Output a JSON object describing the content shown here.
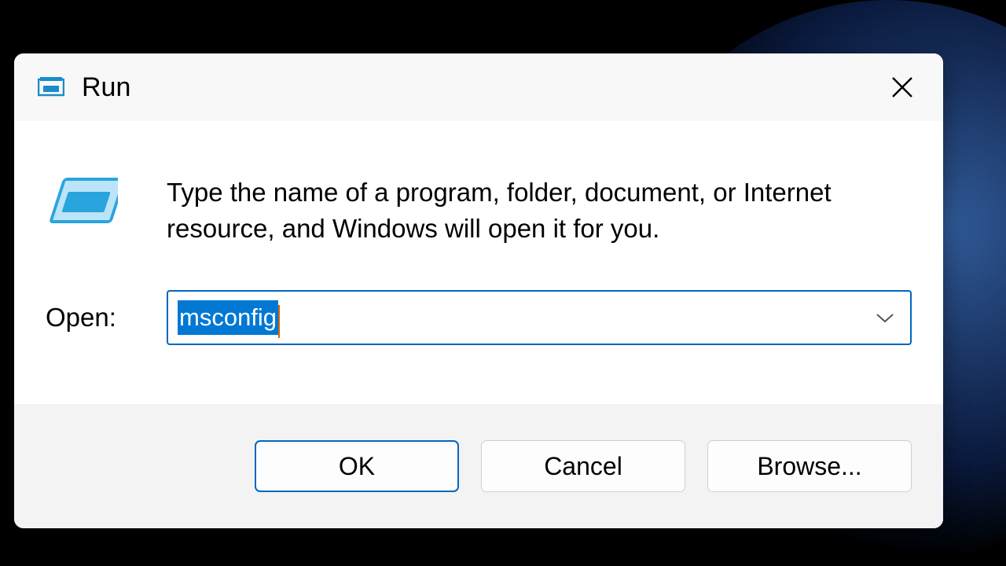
{
  "dialog": {
    "title": "Run",
    "description": "Type the name of a program, folder, document, or Internet resource, and Windows will open it for you.",
    "open_label": "Open:",
    "input_value": "msconfig",
    "buttons": {
      "ok": "OK",
      "cancel": "Cancel",
      "browse": "Browse..."
    }
  },
  "colors": {
    "accent": "#0067c0",
    "selection": "#0078d4"
  }
}
